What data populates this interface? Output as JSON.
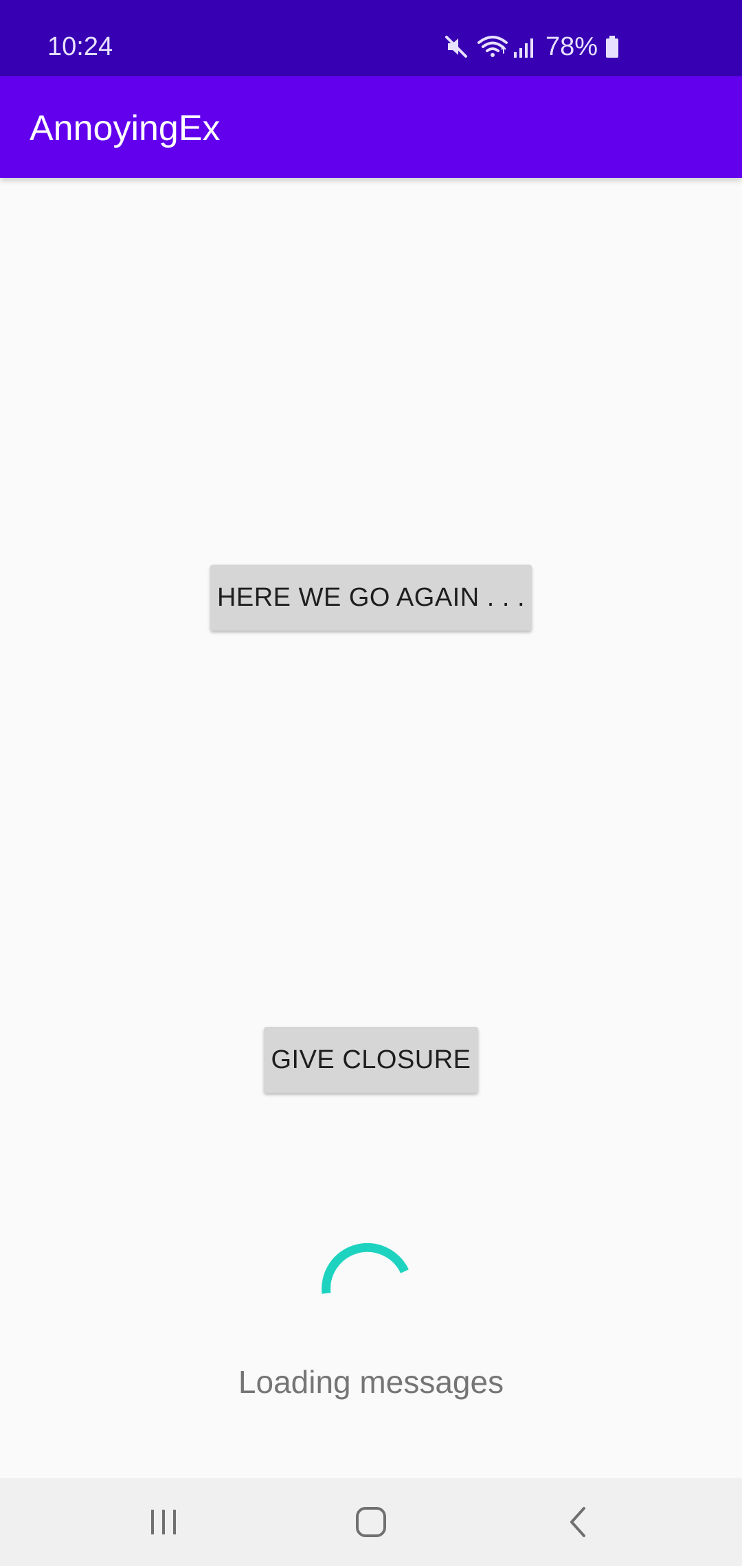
{
  "status_bar": {
    "time": "10:24",
    "battery_percent": "78%",
    "icons": [
      "mute-icon",
      "wifi-icon",
      "signal-icon",
      "battery-icon"
    ]
  },
  "app_bar": {
    "title": "AnnoyingEx"
  },
  "main": {
    "button_again_label": "HERE WE GO AGAIN . . .",
    "button_closure_label": "GIVE CLOSURE",
    "loading_text": "Loading messages"
  },
  "nav_bar": {
    "icons": [
      "recents-icon",
      "home-icon",
      "back-icon"
    ]
  },
  "colors": {
    "status_bar": "#3700b3",
    "app_bar": "#6200ee",
    "spinner": "#1dd3c0",
    "background": "#fafafa",
    "button": "#d6d6d6"
  }
}
